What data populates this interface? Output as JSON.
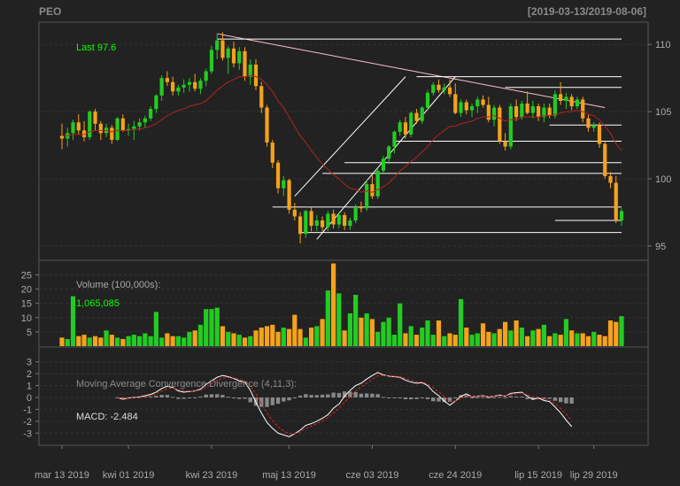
{
  "header": {
    "symbol": "PEO",
    "range": "[2019-03-13/2019-08-06]"
  },
  "colors": {
    "bg": "#222222",
    "up": "#22cc22",
    "down": "#f5a21c",
    "ema": "#b22222",
    "trend": "#ffffff",
    "trend_down": "#ffc0cb",
    "text": "#aaaaaa",
    "last": "#00ff00"
  },
  "chart_data": [
    {
      "type": "candlestick",
      "last_label": "Last 97.6",
      "y_ticks": [
        95,
        100,
        105,
        110
      ],
      "ylim": [
        94.2,
        111.2
      ],
      "candles": [
        [
          103.2,
          104.1,
          102.2,
          103.0
        ],
        [
          103.0,
          103.8,
          102.4,
          103.4
        ],
        [
          103.4,
          104.4,
          102.9,
          104.2
        ],
        [
          104.2,
          104.8,
          103.3,
          103.6
        ],
        [
          103.6,
          104.3,
          102.8,
          103.1
        ],
        [
          103.1,
          105.1,
          102.9,
          105.0
        ],
        [
          105.0,
          105.2,
          103.6,
          104.1
        ],
        [
          104.1,
          104.3,
          102.9,
          103.4
        ],
        [
          103.4,
          104.1,
          103.1,
          103.8
        ],
        [
          103.8,
          104.0,
          102.6,
          102.9
        ],
        [
          102.9,
          104.6,
          102.8,
          104.5
        ],
        [
          104.5,
          104.8,
          103.5,
          103.6
        ],
        [
          103.6,
          104.1,
          103.2,
          103.7
        ],
        [
          103.7,
          104.3,
          102.9,
          103.9
        ],
        [
          103.9,
          104.5,
          103.6,
          104.2
        ],
        [
          104.2,
          104.7,
          103.8,
          104.5
        ],
        [
          104.5,
          105.4,
          104.3,
          105.2
        ],
        [
          105.2,
          106.3,
          104.9,
          106.2
        ],
        [
          106.2,
          107.7,
          105.8,
          107.5
        ],
        [
          107.5,
          108.0,
          106.9,
          107.2
        ],
        [
          107.2,
          107.6,
          106.2,
          106.5
        ],
        [
          106.5,
          107.0,
          106.2,
          106.8
        ],
        [
          106.8,
          107.4,
          106.4,
          107.0
        ],
        [
          107.0,
          107.5,
          106.5,
          107.2
        ],
        [
          107.2,
          107.8,
          106.5,
          106.7
        ],
        [
          106.7,
          107.5,
          106.3,
          107.3
        ],
        [
          107.3,
          108.2,
          106.9,
          108.0
        ],
        [
          108.0,
          109.9,
          107.8,
          109.6
        ],
        [
          109.6,
          110.8,
          108.9,
          110.3
        ],
        [
          110.3,
          110.9,
          108.8,
          109.0
        ],
        [
          109.0,
          109.9,
          107.8,
          109.7
        ],
        [
          109.7,
          110.2,
          108.3,
          108.6
        ],
        [
          108.6,
          109.8,
          108.1,
          109.5
        ],
        [
          109.5,
          109.8,
          107.3,
          107.6
        ],
        [
          107.6,
          108.9,
          107.0,
          108.5
        ],
        [
          108.5,
          108.9,
          106.6,
          106.9
        ],
        [
          106.9,
          107.2,
          104.9,
          105.3
        ],
        [
          105.3,
          105.5,
          102.4,
          102.7
        ],
        [
          102.7,
          102.9,
          100.8,
          101.2
        ],
        [
          101.2,
          101.4,
          98.9,
          99.3
        ],
        [
          99.3,
          100.2,
          98.7,
          99.9
        ],
        [
          99.9,
          100.0,
          97.4,
          97.7
        ],
        [
          97.7,
          98.2,
          96.9,
          97.2
        ],
        [
          97.2,
          97.5,
          95.2,
          95.9
        ],
        [
          95.9,
          97.7,
          95.6,
          97.6
        ],
        [
          97.6,
          97.9,
          96.1,
          96.5
        ],
        [
          96.5,
          97.3,
          96.1,
          96.9
        ],
        [
          96.9,
          97.2,
          96.1,
          96.4
        ],
        [
          96.4,
          97.6,
          96.1,
          97.4
        ],
        [
          97.4,
          97.7,
          96.3,
          96.6
        ],
        [
          96.6,
          97.5,
          96.3,
          97.3
        ],
        [
          97.3,
          97.5,
          96.2,
          96.5
        ],
        [
          96.5,
          97.1,
          96.2,
          96.9
        ],
        [
          96.9,
          98.1,
          96.7,
          97.9
        ],
        [
          97.9,
          98.3,
          97.5,
          97.8
        ],
        [
          97.8,
          99.9,
          97.6,
          99.6
        ],
        [
          99.6,
          100.3,
          98.5,
          98.7
        ],
        [
          98.7,
          100.8,
          98.5,
          100.6
        ],
        [
          100.6,
          101.7,
          100.4,
          101.5
        ],
        [
          101.5,
          102.5,
          101.1,
          102.4
        ],
        [
          102.4,
          103.6,
          101.9,
          103.5
        ],
        [
          103.5,
          104.4,
          103.2,
          104.2
        ],
        [
          104.2,
          104.6,
          103.0,
          103.3
        ],
        [
          103.3,
          105.0,
          103.1,
          104.9
        ],
        [
          104.9,
          105.2,
          104.1,
          104.3
        ],
        [
          104.3,
          105.4,
          104.1,
          105.3
        ],
        [
          105.3,
          106.6,
          105.1,
          106.4
        ],
        [
          106.4,
          107.2,
          106.2,
          107.0
        ],
        [
          107.0,
          107.4,
          106.4,
          106.6
        ],
        [
          106.6,
          107.1,
          106.3,
          106.8
        ],
        [
          106.8,
          107.4,
          106.1,
          106.3
        ],
        [
          106.3,
          107.1,
          104.8,
          104.9
        ],
        [
          104.9,
          105.9,
          104.6,
          105.7
        ],
        [
          105.7,
          105.9,
          104.8,
          105.1
        ],
        [
          105.1,
          105.6,
          104.6,
          105.4
        ],
        [
          105.4,
          106.1,
          104.9,
          105.9
        ],
        [
          105.9,
          106.2,
          105.3,
          105.5
        ],
        [
          105.5,
          106.1,
          104.2,
          104.4
        ],
        [
          104.4,
          105.5,
          103.9,
          105.3
        ],
        [
          105.3,
          105.5,
          102.6,
          102.8
        ],
        [
          102.8,
          103.4,
          102.1,
          102.4
        ],
        [
          102.4,
          105.6,
          102.2,
          105.4
        ],
        [
          105.4,
          105.9,
          104.3,
          104.6
        ],
        [
          104.6,
          105.8,
          104.4,
          105.6
        ],
        [
          105.6,
          106.5,
          104.8,
          104.9
        ],
        [
          104.9,
          105.8,
          104.5,
          105.4
        ],
        [
          105.4,
          105.6,
          104.3,
          104.6
        ],
        [
          104.6,
          105.6,
          104.2,
          105.3
        ],
        [
          105.3,
          105.6,
          104.5,
          104.7
        ],
        [
          104.7,
          106.6,
          104.5,
          106.3
        ],
        [
          106.3,
          107.2,
          105.5,
          105.8
        ],
        [
          105.8,
          106.4,
          105.2,
          106.1
        ],
        [
          106.1,
          106.3,
          105.1,
          105.4
        ],
        [
          105.4,
          106.1,
          105.2,
          105.9
        ],
        [
          105.9,
          106.1,
          104.2,
          104.5
        ],
        [
          104.5,
          104.8,
          103.5,
          103.8
        ],
        [
          103.8,
          104.2,
          103.5,
          104.0
        ],
        [
          104.0,
          104.2,
          102.3,
          102.6
        ],
        [
          102.6,
          102.8,
          100.0,
          100.2
        ],
        [
          100.2,
          100.5,
          99.3,
          99.7
        ],
        [
          99.7,
          100.2,
          96.7,
          96.9
        ],
        [
          96.9,
          97.8,
          96.5,
          97.6
        ]
      ],
      "ema": [
        103.2,
        103.2,
        103.3,
        103.3,
        103.3,
        103.5,
        103.6,
        103.6,
        103.6,
        103.5,
        103.6,
        103.6,
        103.6,
        103.7,
        103.7,
        103.8,
        103.9,
        104.1,
        104.4,
        104.7,
        104.9,
        105.1,
        105.2,
        105.4,
        105.5,
        105.6,
        105.8,
        106.2,
        106.6,
        106.9,
        107.2,
        107.4,
        107.6,
        107.6,
        107.7,
        107.6,
        107.4,
        107.0,
        106.5,
        105.8,
        105.3,
        104.6,
        103.9,
        103.2,
        102.7,
        102.1,
        101.6,
        101.1,
        100.7,
        100.3,
        100.0,
        99.6,
        99.3,
        99.2,
        99.0,
        99.1,
        99.0,
        99.2,
        99.4,
        99.7,
        100.1,
        100.6,
        100.9,
        101.3,
        101.6,
        102.0,
        102.4,
        102.9,
        103.3,
        103.6,
        103.9,
        103.9,
        104.1,
        104.2,
        104.3,
        104.5,
        104.6,
        104.6,
        104.7,
        104.5,
        104.3,
        104.4,
        104.4,
        104.6,
        104.6,
        104.6,
        104.6,
        104.7,
        104.7,
        104.8,
        104.9,
        105.0,
        105.0,
        105.1,
        105.0,
        104.8,
        104.7,
        104.4,
        103.9,
        103.4,
        102.6,
        102.1
      ],
      "trend_lines": [
        {
          "from": [
            28,
            110.8
          ],
          "to": [
            98,
            105.3
          ],
          "color": "pink"
        },
        {
          "from": [
            46,
            95.5
          ],
          "to": [
            71,
            107.6
          ]
        },
        {
          "from": [
            42,
            98.7
          ],
          "to": [
            62,
            107.6
          ]
        },
        {
          "from": [
            28,
            110.4
          ],
          "to": [
            101,
            110.4
          ]
        },
        {
          "from": [
            64,
            107.6
          ],
          "to": [
            101,
            107.6
          ]
        },
        {
          "from": [
            80,
            106.8
          ],
          "to": [
            101,
            106.8
          ]
        },
        {
          "from": [
            88,
            104.0
          ],
          "to": [
            101,
            104.0
          ]
        },
        {
          "from": [
            60,
            102.8
          ],
          "to": [
            101,
            102.8
          ]
        },
        {
          "from": [
            51,
            101.2
          ],
          "to": [
            101,
            101.2
          ]
        },
        {
          "from": [
            47,
            100.4
          ],
          "to": [
            101,
            100.4
          ]
        },
        {
          "from": [
            38,
            97.9
          ],
          "to": [
            101,
            97.9
          ]
        },
        {
          "from": [
            89,
            96.9
          ],
          "to": [
            101,
            96.9
          ]
        },
        {
          "from": [
            43,
            96.0
          ],
          "to": [
            101,
            96.0
          ]
        }
      ]
    },
    {
      "type": "bar",
      "title": "Volume (100,000s):",
      "last_label": "1,065,085",
      "y_ticks": [
        5,
        10,
        15,
        20,
        25
      ],
      "ylim": [
        0,
        29.5
      ],
      "values": [
        3,
        2.5,
        17.5,
        3.5,
        4,
        3,
        3.5,
        3,
        5.5,
        4,
        3,
        2.5,
        3.5,
        4,
        3.5,
        4.5,
        3.5,
        12,
        3,
        4.5,
        3.5,
        3.5,
        3,
        5,
        5.5,
        7.5,
        13,
        13,
        13.5,
        7,
        5,
        4.5,
        4,
        3,
        3.5,
        5.5,
        6.5,
        7,
        7.5,
        5,
        6.5,
        6,
        11,
        6,
        3,
        6.5,
        7,
        9.5,
        19.5,
        29,
        18.5,
        5.5,
        11.5,
        18,
        10,
        11.5,
        9.5,
        5,
        8.5,
        10,
        4,
        15,
        4.5,
        7,
        4,
        6.5,
        9,
        4,
        9,
        3.5,
        4.5,
        4,
        16.5,
        6.5,
        4,
        4.5,
        8,
        5,
        4.5,
        6,
        8.5,
        5.5,
        9,
        6.5,
        3.5,
        5.5,
        6,
        7.5,
        3.5,
        4.5,
        4,
        9.5,
        5.5,
        4.5,
        4.5,
        3.5,
        5,
        4,
        3.5,
        9,
        8.5,
        10.5
      ]
    },
    {
      "type": "line",
      "title": "Moving Average Convergence Divergence (4,11,3):",
      "last_label": "MACD: -2.484",
      "y_ticks": [
        -3,
        -2,
        -1,
        0,
        1,
        2,
        3
      ],
      "ylim": [
        -3.8,
        3.8
      ],
      "start_index": 10,
      "macd": [
        0.0,
        -0.15,
        -0.05,
        0.0,
        0.05,
        0.15,
        0.25,
        0.45,
        0.75,
        0.95,
        0.85,
        0.55,
        0.45,
        0.5,
        0.55,
        0.7,
        1.1,
        1.4,
        1.7,
        1.85,
        1.75,
        1.6,
        1.4,
        1.3,
        0.6,
        -0.4,
        -1.3,
        -2.1,
        -2.6,
        -3.0,
        -3.15,
        -3.3,
        -3.05,
        -2.75,
        -2.35,
        -2.2,
        -2.0,
        -1.75,
        -1.45,
        -0.9,
        -0.55,
        0.1,
        0.6,
        1.0,
        1.2,
        1.55,
        1.85,
        2.1,
        1.9,
        1.8,
        1.75,
        1.7,
        1.45,
        1.3,
        1.2,
        1.25,
        1.0,
        0.5,
        0.15,
        -0.3,
        -0.65,
        -0.3,
        0.1,
        0.3,
        0.05,
        0.1,
        0.15,
        0.05,
        0.1,
        0.2,
        0.1,
        0.35,
        0.4,
        0.45,
        0.1,
        -0.15,
        -0.05,
        -0.25,
        -0.35,
        -0.8,
        -1.3,
        -1.9,
        -2.45
      ],
      "signal": [
        0.0,
        -0.08,
        -0.06,
        -0.03,
        0.01,
        0.08,
        0.17,
        0.31,
        0.53,
        0.74,
        0.8,
        0.67,
        0.56,
        0.53,
        0.54,
        0.62,
        0.86,
        1.13,
        1.42,
        1.63,
        1.69,
        1.65,
        1.52,
        1.41,
        1.0,
        0.3,
        -0.5,
        -1.3,
        -1.95,
        -2.47,
        -2.81,
        -3.06,
        -3.05,
        -2.9,
        -2.63,
        -2.41,
        -2.2,
        -1.98,
        -1.71,
        -1.31,
        -0.93,
        -0.41,
        0.1,
        0.55,
        0.88,
        1.21,
        1.53,
        1.82,
        1.86,
        1.83,
        1.79,
        1.75,
        1.6,
        1.45,
        1.33,
        1.29,
        1.14,
        0.82,
        0.49,
        0.09,
        -0.28,
        -0.29,
        -0.1,
        0.1,
        0.07,
        0.09,
        0.12,
        0.08,
        0.09,
        0.15,
        0.12,
        0.24,
        0.32,
        0.38,
        0.24,
        0.05,
        0.0,
        -0.12,
        -0.24,
        -0.52,
        -0.91,
        -1.4,
        -1.93
      ]
    }
  ],
  "x_axis": {
    "labels": [
      "mar 13 2019",
      "kwi 01 2019",
      "kwi 23 2019",
      "maj 13 2019",
      "cze 03 2019",
      "cze 24 2019",
      "lip 15 2019",
      "lip 29 2019"
    ],
    "label_index": [
      0,
      12,
      27,
      41,
      56,
      71,
      86,
      96
    ]
  }
}
